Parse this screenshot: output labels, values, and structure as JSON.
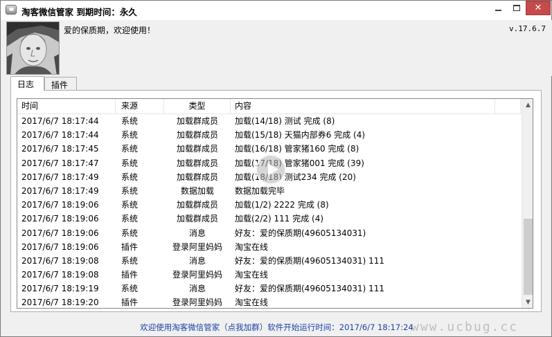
{
  "window": {
    "title": "淘客微信管家 到期时间：永久",
    "minimize_icon": "minimize-icon",
    "maximize_icon": "maximize-icon",
    "close_icon": "close-icon",
    "close_color": "#c74a4a"
  },
  "header": {
    "welcome": "爱的保质期，欢迎使用！",
    "version": "v.17.6.7",
    "avatar": "user-avatar-photo"
  },
  "tabs": [
    {
      "label": "日志",
      "active": true
    },
    {
      "label": "插件",
      "active": false
    }
  ],
  "log": {
    "columns": [
      "时间",
      "来源",
      "类型",
      "内容"
    ],
    "rows": [
      {
        "time": "2017/6/7 18:17:44",
        "source": "系统",
        "type": "加载群成员",
        "content": "加载(14/18) 测试 完成 (8)"
      },
      {
        "time": "2017/6/7 18:17:44",
        "source": "系统",
        "type": "加载群成员",
        "content": "加载(15/18) 天猫内部券6 完成 (4)"
      },
      {
        "time": "2017/6/7 18:17:45",
        "source": "系统",
        "type": "加载群成员",
        "content": "加载(16/18) 管家猪160 完成 (8)"
      },
      {
        "time": "2017/6/7 18:17:47",
        "source": "系统",
        "type": "加载群成员",
        "content": "加载(17/18) 管家猪001 完成 (39)"
      },
      {
        "time": "2017/6/7 18:17:49",
        "source": "系统",
        "type": "加载群成员",
        "content": "加载(18/18) 测试234 完成 (20)"
      },
      {
        "time": "2017/6/7 18:17:49",
        "source": "系统",
        "type": "数据加载",
        "content": "数据加载完毕"
      },
      {
        "time": "2017/6/7 18:19:06",
        "source": "系统",
        "type": "加载群成员",
        "content": "加载(1/2) 2222 完成 (8)"
      },
      {
        "time": "2017/6/7 18:19:06",
        "source": "系统",
        "type": "加载群成员",
        "content": "加载(2/2) 111 完成 (4)"
      },
      {
        "time": "2017/6/7 18:19:06",
        "source": "系统",
        "type": "消息",
        "content": "好友：爱的保质期(49605134031)"
      },
      {
        "time": "2017/6/7 18:19:06",
        "source": "插件",
        "type": "登录阿里妈妈",
        "content": "淘宝在线"
      },
      {
        "time": "2017/6/7 18:19:08",
        "source": "系统",
        "type": "消息",
        "content": "好友：爱的保质期(49605134031) 111"
      },
      {
        "time": "2017/6/7 18:19:08",
        "source": "插件",
        "type": "登录阿里妈妈",
        "content": "淘宝在线"
      },
      {
        "time": "2017/6/7 18:19:19",
        "source": "系统",
        "type": "消息",
        "content": "好友：爱的保质期(49605134031) 111"
      },
      {
        "time": "2017/6/7 18:19:20",
        "source": "插件",
        "type": "登录阿里妈妈",
        "content": "淘宝在线"
      }
    ]
  },
  "status": {
    "text": "欢迎使用淘客微信管家（点我加群）软件开始运行时间：2017/6/7 18:17:24",
    "color": "#1a3fa8"
  },
  "watermark": "www.ucbug.cc"
}
